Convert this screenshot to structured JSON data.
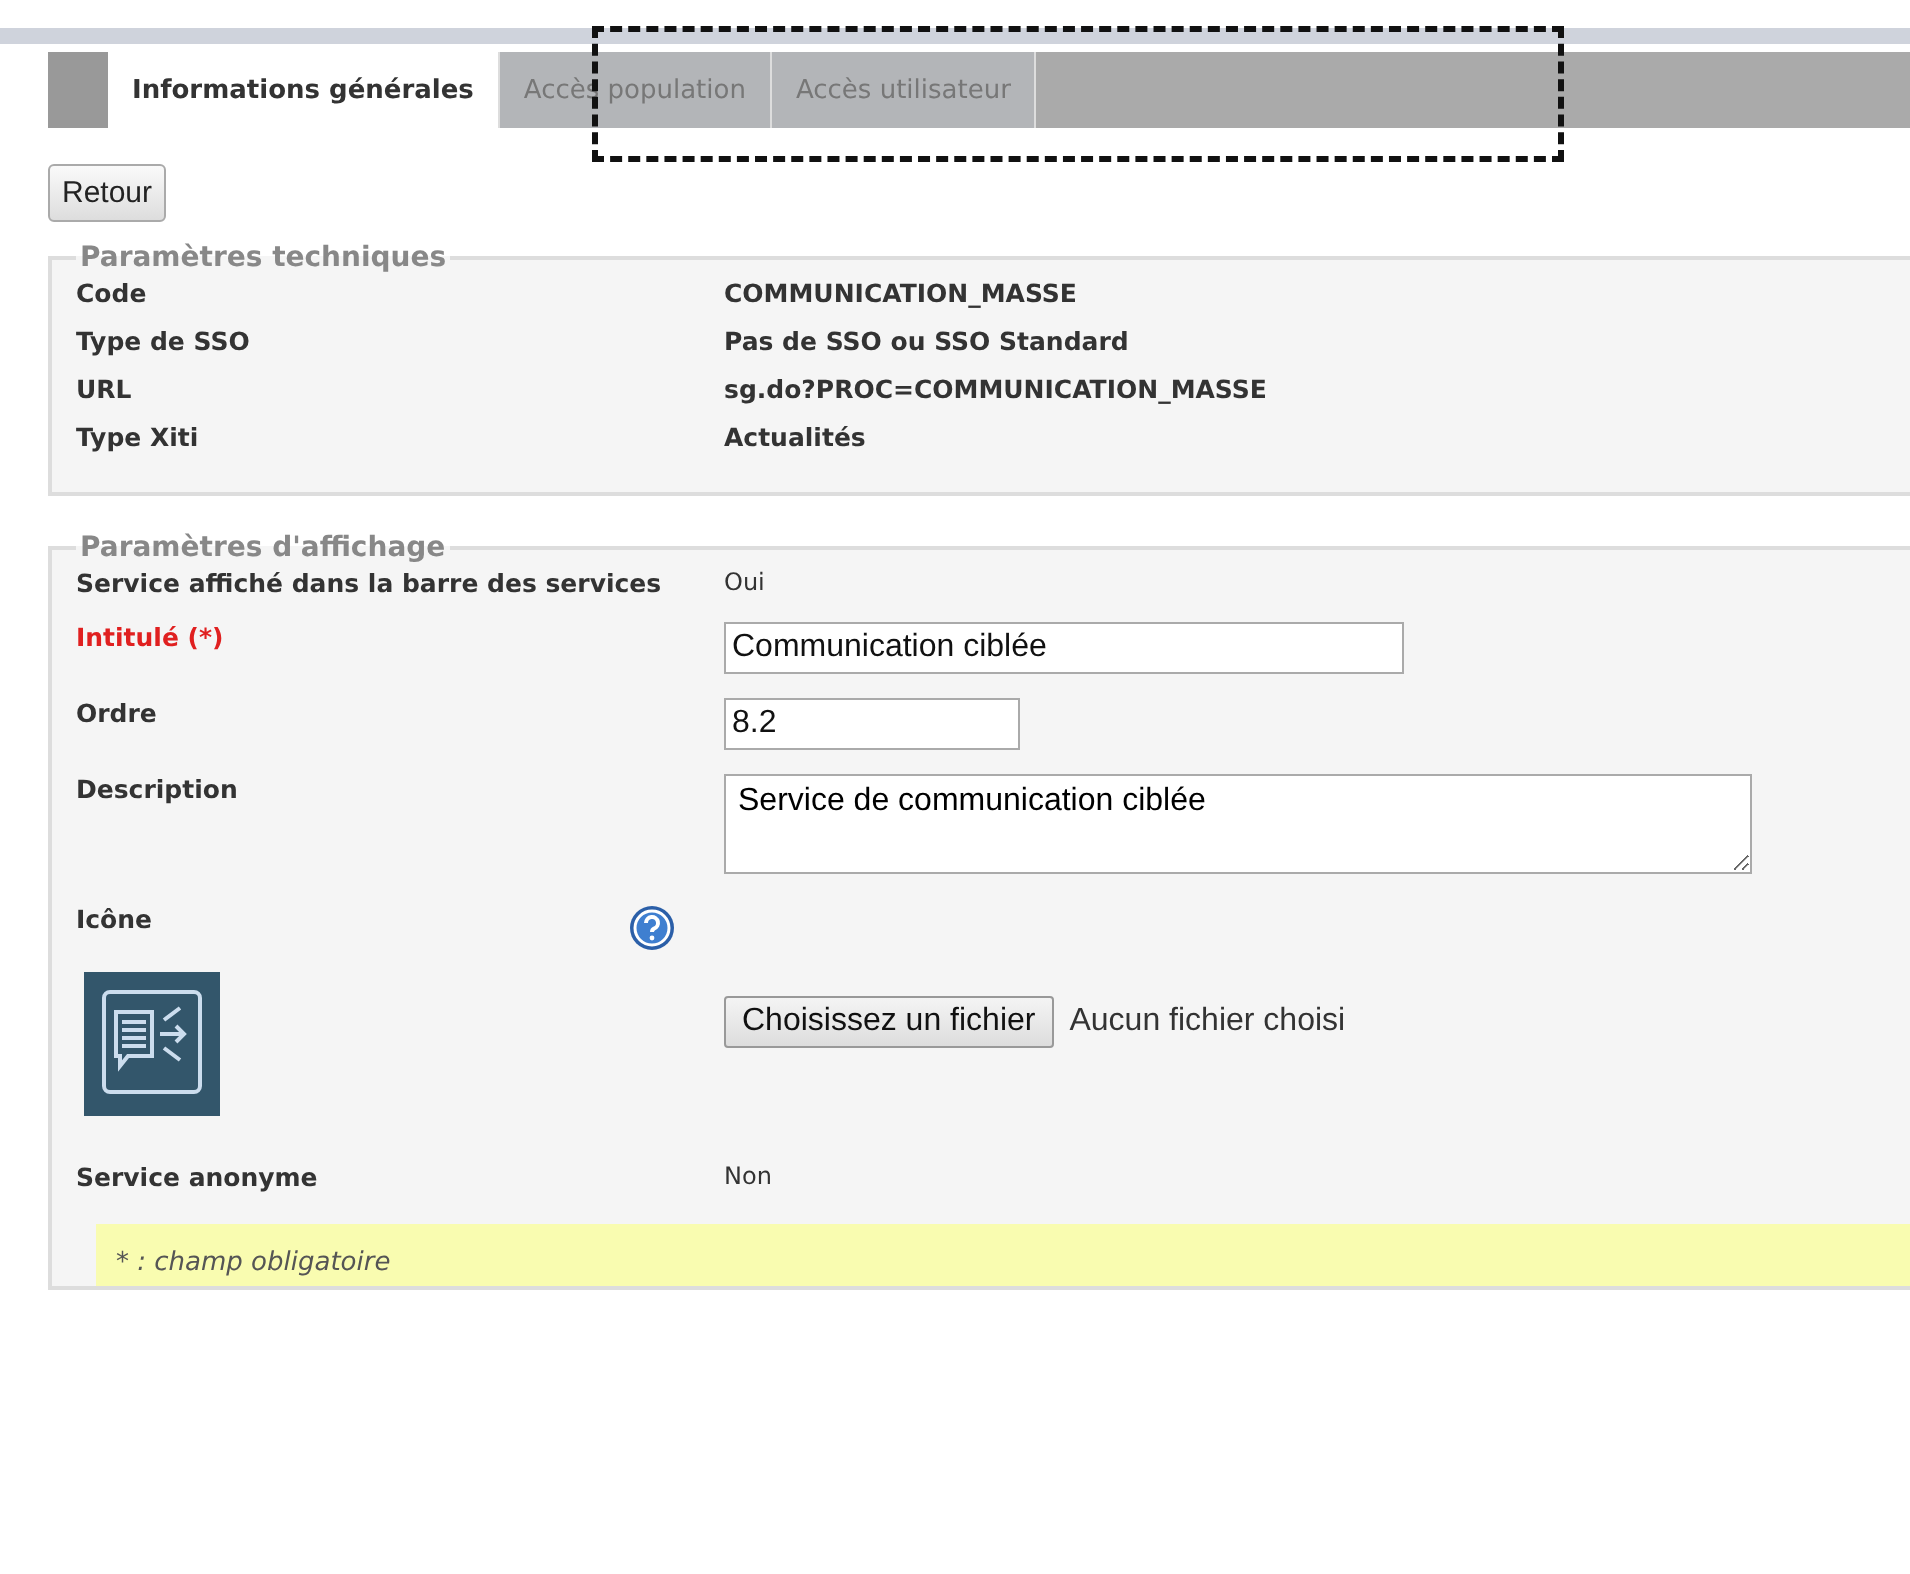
{
  "tabs": [
    {
      "label": "Informations générales",
      "selected": true
    },
    {
      "label": "Accès population",
      "selected": false
    },
    {
      "label": "Accès utilisateur",
      "selected": false
    }
  ],
  "back_button": "Retour",
  "technical": {
    "legend": "Paramètres techniques",
    "rows": [
      {
        "label": "Code",
        "value": "COMMUNICATION_MASSE"
      },
      {
        "label": "Type de SSO",
        "value": "Pas de SSO ou SSO Standard"
      },
      {
        "label": "URL",
        "value": "sg.do?PROC=COMMUNICATION_MASSE"
      },
      {
        "label": "Type Xiti",
        "value": "Actualités"
      }
    ]
  },
  "display": {
    "legend": "Paramètres d'affichage",
    "rows": [
      {
        "kind": "text",
        "label": "Service affiché dans la barre des services",
        "required": false,
        "value": "Oui"
      },
      {
        "kind": "input",
        "label": "Intitulé (*)",
        "required": true,
        "value": "Communication ciblée",
        "wide": true
      },
      {
        "kind": "input",
        "label": "Ordre",
        "required": false,
        "value": "8.2",
        "wide": false
      },
      {
        "kind": "textarea",
        "label": "Description",
        "required": false,
        "value": "Service de communication ciblée"
      },
      {
        "kind": "file",
        "label": "Icône",
        "required": false,
        "button": "Choisissez un fichier",
        "status": "Aucun fichier choisi"
      },
      {
        "kind": "text",
        "label": "Service anonyme",
        "required": false,
        "value": "Non"
      }
    ]
  },
  "note": "* : champ obligatoire"
}
